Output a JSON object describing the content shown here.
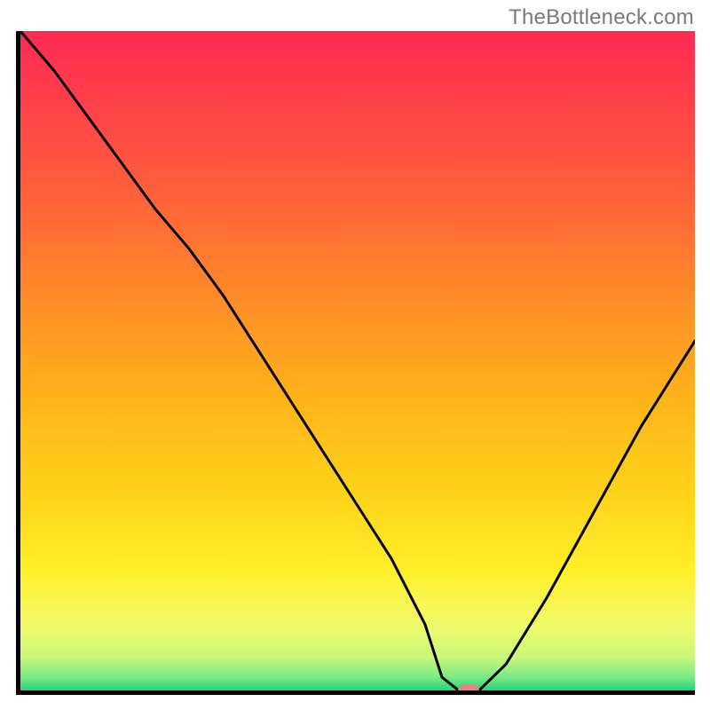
{
  "watermark": "TheBottleneck.com",
  "chart_data": {
    "type": "line",
    "title": "",
    "xlabel": "",
    "ylabel": "",
    "x": [
      0.0,
      0.05,
      0.1,
      0.15,
      0.2,
      0.25,
      0.3,
      0.35,
      0.4,
      0.45,
      0.5,
      0.55,
      0.6,
      0.625,
      0.65,
      0.68,
      0.72,
      0.78,
      0.85,
      0.92,
      1.0
    ],
    "values": [
      1.0,
      0.94,
      0.87,
      0.8,
      0.73,
      0.67,
      0.6,
      0.52,
      0.44,
      0.36,
      0.28,
      0.2,
      0.1,
      0.02,
      0.0,
      0.0,
      0.04,
      0.14,
      0.27,
      0.4,
      0.53
    ],
    "xlim": [
      0,
      1
    ],
    "ylim": [
      0,
      1
    ],
    "marker": {
      "x": 0.665,
      "y": 0.0
    },
    "background_gradient": [
      {
        "stop": 0.0,
        "color": "#ff2a54"
      },
      {
        "stop": 0.2,
        "color": "#ff5440"
      },
      {
        "stop": 0.4,
        "color": "#ff8a2a"
      },
      {
        "stop": 0.55,
        "color": "#ffb21a"
      },
      {
        "stop": 0.7,
        "color": "#ffd21a"
      },
      {
        "stop": 0.82,
        "color": "#fff02a"
      },
      {
        "stop": 0.9,
        "color": "#f3f96a"
      },
      {
        "stop": 0.95,
        "color": "#c9f77a"
      },
      {
        "stop": 0.98,
        "color": "#7be985"
      },
      {
        "stop": 1.0,
        "color": "#1fd67a"
      }
    ]
  }
}
